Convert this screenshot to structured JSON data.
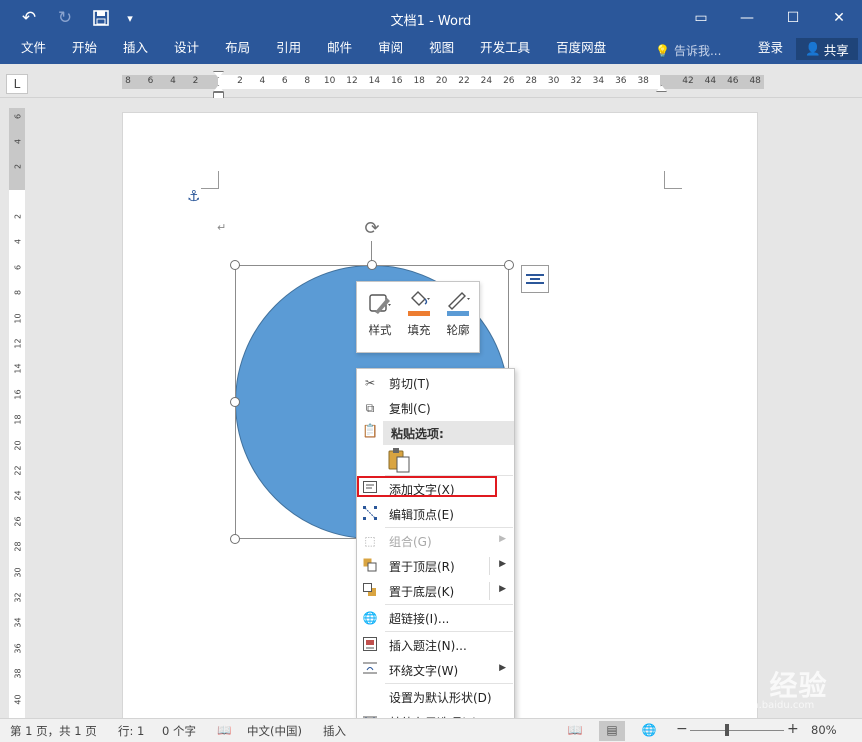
{
  "window": {
    "title": "文档1 - Word",
    "controls": {
      "ribbon_display": "▭",
      "minimize": "—",
      "maximize": "☐",
      "close": "✕"
    }
  },
  "quick_access": {
    "undo": "↶",
    "redo": "↻",
    "save": "💾",
    "customize": "▾"
  },
  "ribbon": {
    "tabs": [
      "文件",
      "开始",
      "插入",
      "设计",
      "布局",
      "引用",
      "邮件",
      "审阅",
      "视图",
      "开发工具",
      "百度网盘"
    ],
    "tell_me": "告诉我...",
    "sign_in": "登录",
    "share": "共享"
  },
  "ruler": {
    "corner": "L",
    "left_nums": [
      "8",
      "6",
      "4",
      "2"
    ],
    "right_nums": [
      "2",
      "4",
      "6",
      "8",
      "10",
      "12",
      "14",
      "16",
      "18",
      "20",
      "22",
      "24",
      "26",
      "28",
      "30",
      "32",
      "34",
      "36",
      "38"
    ],
    "margin_nums": [
      "42",
      "44",
      "46",
      "48"
    ],
    "vertical_nums": [
      "6",
      "4",
      "2",
      "2",
      "4",
      "6",
      "8",
      "10",
      "12",
      "14",
      "16",
      "18",
      "20",
      "22",
      "24",
      "26",
      "28",
      "30",
      "32",
      "34",
      "36",
      "38",
      "40"
    ]
  },
  "document": {
    "paragraph_mark": "↵",
    "anchor": "⚓"
  },
  "mini_toolbar": {
    "style_label": "样式",
    "fill_label": "填充",
    "outline_label": "轮廓",
    "fill_color": "#ed7d31",
    "outline_color": "#5b9bd5"
  },
  "context_menu": {
    "cut": "剪切(T)",
    "copy": "复制(C)",
    "paste_options": "粘贴选项:",
    "add_text": "添加文字(X)",
    "edit_points": "编辑顶点(E)",
    "group": "组合(G)",
    "bring_front": "置于顶层(R)",
    "send_back": "置于底层(K)",
    "hyperlink": "超链接(I)...",
    "insert_caption": "插入题注(N)...",
    "wrap_text": "环绕文字(W)",
    "set_default": "设置为默认形状(D)",
    "more_layout": "其他布局选项(L)..."
  },
  "statusbar": {
    "page": "第 1 页，共 1 页",
    "line": "行: 1",
    "words": "0 个字",
    "language": "中文(中国)",
    "mode": "插入",
    "zoom": "80%",
    "zoom_minus": "−",
    "zoom_plus": "+"
  },
  "watermark": {
    "text": "Baidu 经验",
    "sub": "jingyan.baidu.com"
  },
  "colors": {
    "ribbon": "#2b579a",
    "shape_fill": "#5b9bd5",
    "highlight": "#e0191f"
  }
}
